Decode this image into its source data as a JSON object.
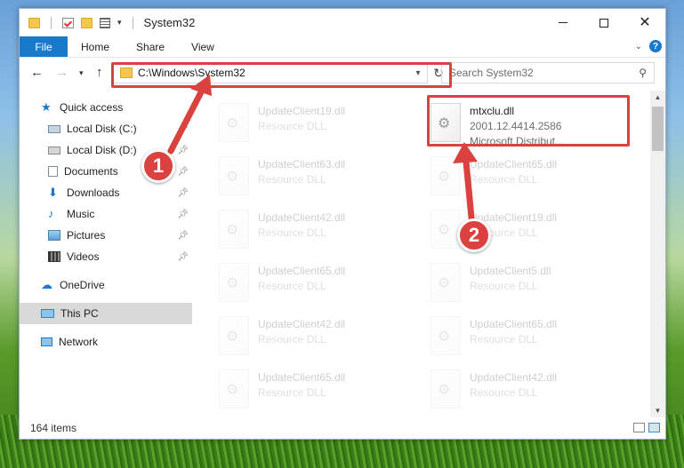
{
  "window": {
    "title": "System32"
  },
  "ribbon": {
    "tabs": [
      "File",
      "Home",
      "Share",
      "View"
    ]
  },
  "address": {
    "path": "C:\\Windows\\System32"
  },
  "search": {
    "placeholder": "Search System32"
  },
  "sidebar": {
    "items": [
      {
        "label": "Quick access",
        "icon": "star-icon",
        "color": "#1979ca",
        "pinned": false
      },
      {
        "label": "Local Disk (C:)",
        "icon": "drive-icon",
        "color": "#6a8fb3",
        "pinned": true
      },
      {
        "label": "Local Disk (D:)",
        "icon": "drive-icon",
        "color": "#8a8a8a",
        "pinned": true
      },
      {
        "label": "Documents",
        "icon": "documents-icon",
        "color": "#7a8ea3",
        "pinned": true
      },
      {
        "label": "Downloads",
        "icon": "download-icon",
        "color": "#1979ca",
        "pinned": true
      },
      {
        "label": "Music",
        "icon": "music-icon",
        "color": "#1979ca",
        "pinned": true
      },
      {
        "label": "Pictures",
        "icon": "pictures-icon",
        "color": "#5aa0d8",
        "pinned": true
      },
      {
        "label": "Videos",
        "icon": "video-icon",
        "color": "#333333",
        "pinned": true
      },
      {
        "label": "OneDrive",
        "icon": "cloud-icon",
        "color": "#1979ca",
        "pinned": false
      },
      {
        "label": "This PC",
        "icon": "computer-icon",
        "color": "#5aa0d8",
        "pinned": false,
        "selected": true
      },
      {
        "label": "Network",
        "icon": "network-icon",
        "color": "#1979ca",
        "pinned": false
      }
    ]
  },
  "files": {
    "highlighted": {
      "name": "mtxclu.dll",
      "version": "2001.12.4414.2586",
      "company": "Microsoft Distribut..."
    },
    "left_column": [
      {
        "name": "UpdateClient19.dll",
        "type": "Resource DLL"
      },
      {
        "name": "UpdateClient63.dll",
        "type": "Resource DLL"
      },
      {
        "name": "UpdateClient42.dll",
        "type": "Resource DLL"
      },
      {
        "name": "UpdateClient65.dll",
        "type": "Resource DLL"
      },
      {
        "name": "UpdateClient42.dll",
        "type": "Resource DLL"
      },
      {
        "name": "UpdateClient65.dll",
        "type": "Resource DLL"
      }
    ],
    "right_column": [
      {
        "name": "UpdateClient65.dll",
        "type": "Resource DLL"
      },
      {
        "name": "UpdateClient19.dll",
        "type": "Resource DLL"
      },
      {
        "name": "UpdateClient5.dll",
        "type": "Resource DLL"
      },
      {
        "name": "UpdateClient65.dll",
        "type": "Resource DLL"
      },
      {
        "name": "UpdateClient42.dll",
        "type": "Resource DLL"
      }
    ]
  },
  "status": {
    "items": "164 items"
  },
  "callouts": [
    "1",
    "2"
  ],
  "colors": {
    "accent": "#1979ca",
    "highlight": "#d9423f"
  }
}
